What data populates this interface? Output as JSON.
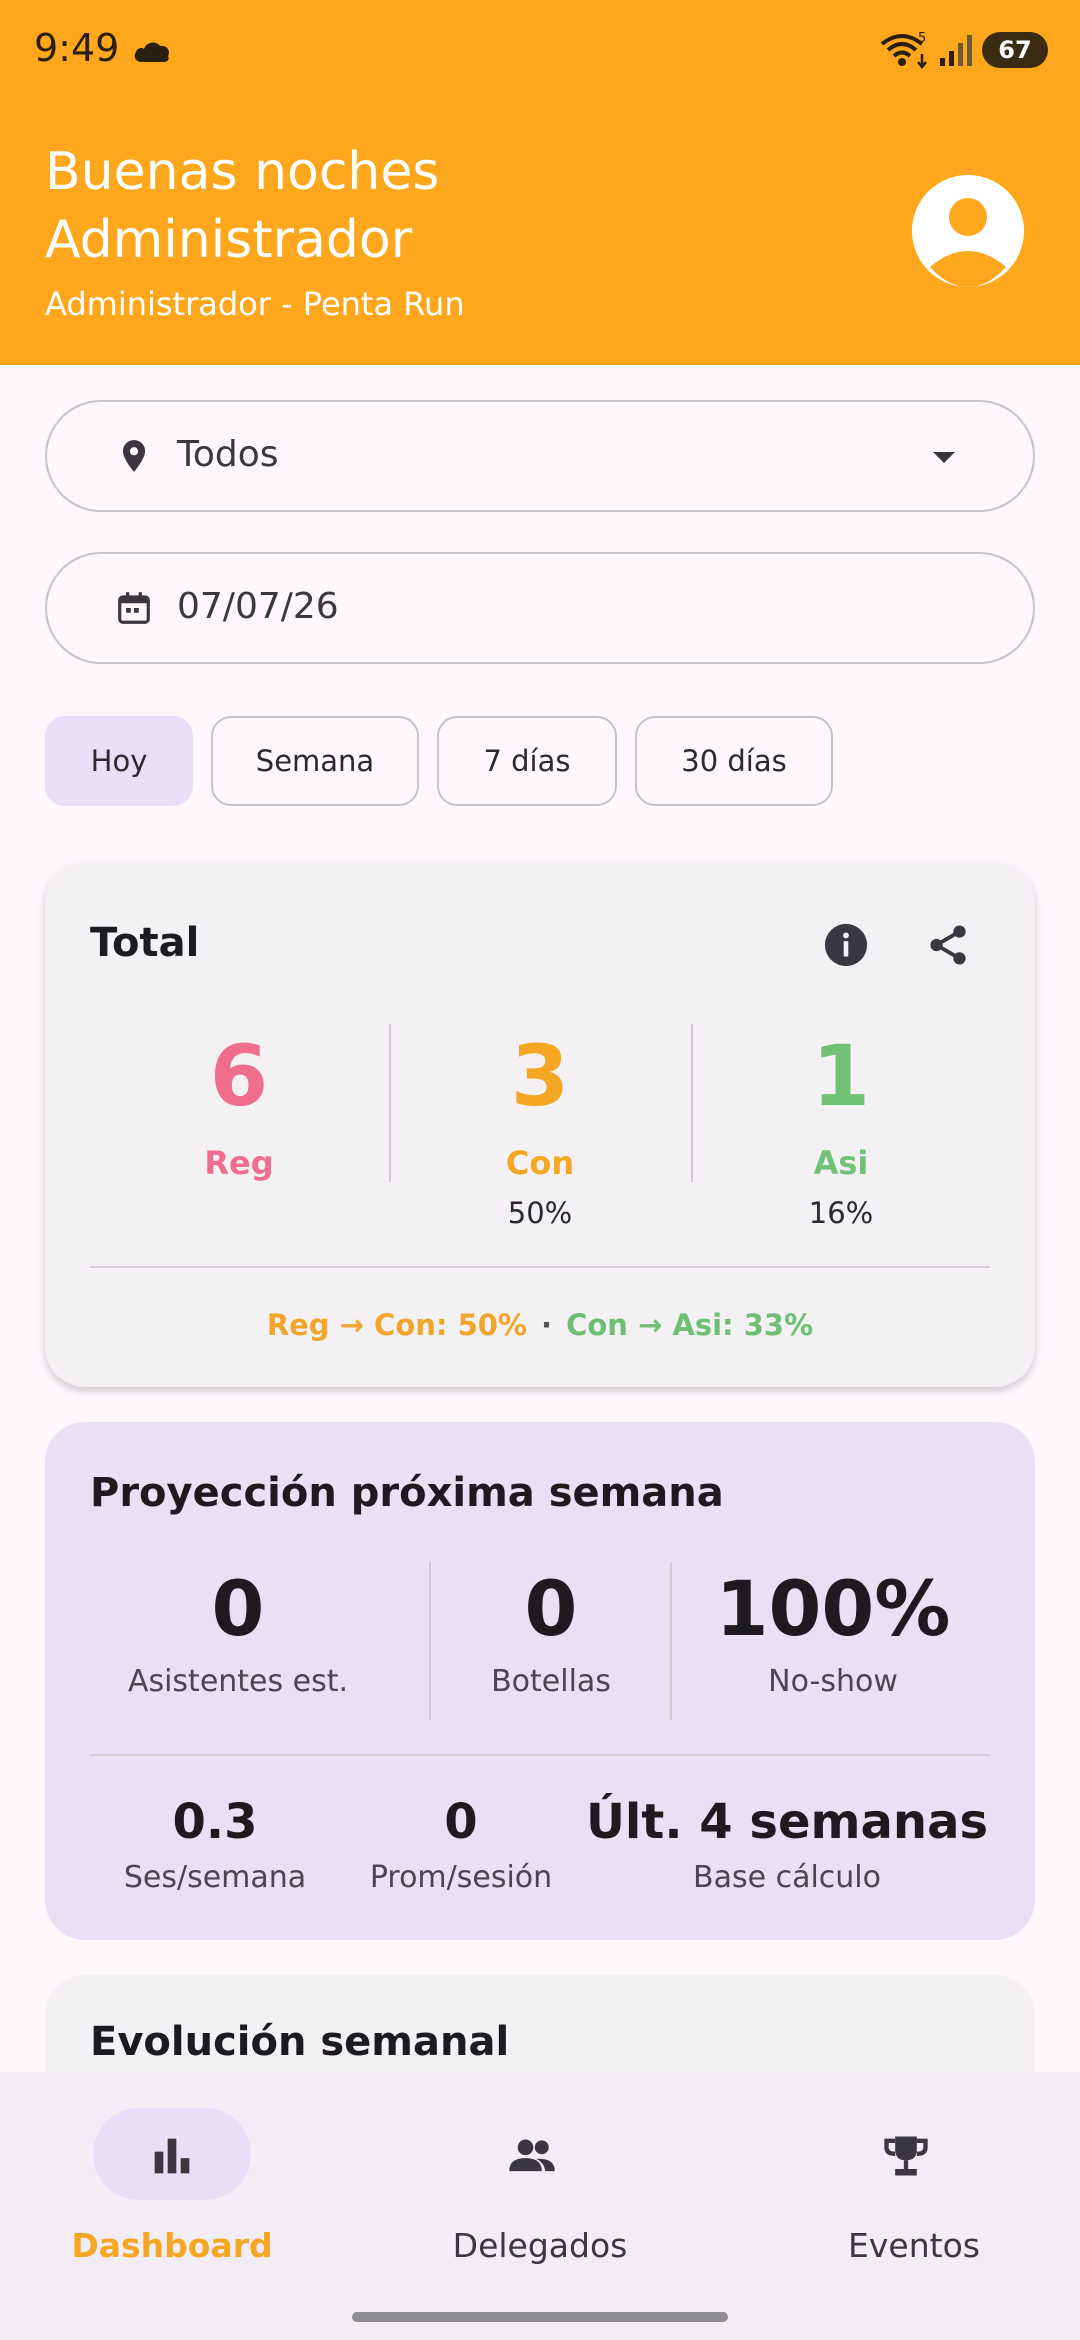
{
  "status_bar": {
    "time": "9:49",
    "battery": "67"
  },
  "header": {
    "greeting_line1": "Buenas noches",
    "greeting_line2": "Administrador",
    "subtitle": "Administrador - Penta Run"
  },
  "filters": {
    "location": "Todos",
    "date": "07/07/26",
    "chips": [
      "Hoy",
      "Semana",
      "7 días",
      "30 días"
    ],
    "selected_chip": "Hoy"
  },
  "total_card": {
    "title": "Total",
    "metrics": [
      {
        "value": "6",
        "label": "Reg",
        "percent": "",
        "color": "#f06d8d"
      },
      {
        "value": "3",
        "label": "Con",
        "percent": "50%",
        "color": "#f5a623"
      },
      {
        "value": "1",
        "label": "Asi",
        "percent": "16%",
        "color": "#72c276"
      }
    ],
    "conversion_1": "Reg → Con: 50%",
    "separator": "·",
    "conversion_2": "Con → Asi: 33%"
  },
  "projection_card": {
    "title": "Proyección próxima semana",
    "top": [
      {
        "value": "0",
        "label": "Asistentes est."
      },
      {
        "value": "0",
        "label": "Botellas"
      },
      {
        "value": "100%",
        "label": "No-show"
      }
    ],
    "bottom": [
      {
        "value": "0.3",
        "label": "Ses/semana"
      },
      {
        "value": "0",
        "label": "Prom/sesión"
      },
      {
        "value": "Últ. 4 semanas",
        "label": "Base cálculo"
      }
    ]
  },
  "evolution_card": {
    "title": "Evolución semanal"
  },
  "bottom_nav": {
    "items": [
      {
        "label": "Dashboard",
        "icon": "bar-chart-icon",
        "active": true
      },
      {
        "label": "Delegados",
        "icon": "people-icon",
        "active": false
      },
      {
        "label": "Eventos",
        "icon": "trophy-icon",
        "active": false
      }
    ]
  },
  "colors": {
    "accent": "#ffa71c",
    "reg": "#f06d8d",
    "con": "#f5a623",
    "asi": "#72c276"
  }
}
